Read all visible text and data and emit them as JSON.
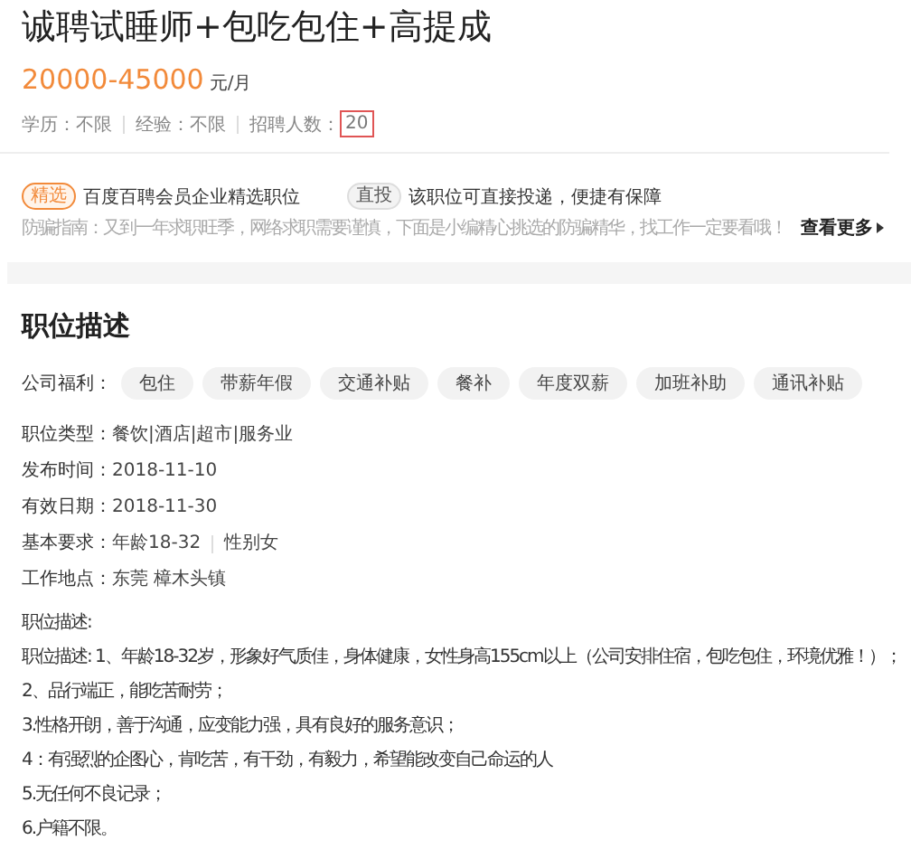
{
  "job": {
    "title": "诚聘试睡师+包吃包住+高提成",
    "salary": "20000-45000",
    "salary_unit": "元/月",
    "requirements": [
      {
        "label": "学历：",
        "value": "不限",
        "highlighted": false
      },
      {
        "label": "经验：",
        "value": "不限",
        "highlighted": false
      },
      {
        "label": "招聘人数：",
        "value": "20",
        "highlighted": true
      }
    ]
  },
  "features": [
    {
      "badge": "精选",
      "kind": "accent",
      "text": "百度百聘会员企业精选职位"
    },
    {
      "badge": "直投",
      "kind": "plain",
      "text": "该职位可直接投递，便捷有保障"
    }
  ],
  "fraud_tip": {
    "text": "防骗指南：又到一年求职旺季，网络求职需要谨慎，下面是小编精心挑选的防骗精华，找工作一定要看哦！",
    "link": "查看更多"
  },
  "description": {
    "heading": "职位描述",
    "benefits_label": "公司福利：",
    "benefits": [
      "包住",
      "带薪年假",
      "交通补贴",
      "餐补",
      "年度双薪",
      "加班补助",
      "通讯补贴"
    ],
    "fields": [
      {
        "label": "职位类型：",
        "value": "餐饮|酒店|超市|服务业"
      },
      {
        "label": "发布时间：",
        "value": "2018-11-10"
      },
      {
        "label": "有效日期：",
        "value": "2018-11-30"
      },
      {
        "label": "基本要求：",
        "value": "年龄18-32",
        "value_2": "性别女"
      },
      {
        "label": "工作地点：",
        "value": "东莞 樟木头镇"
      }
    ],
    "body_heading": "职位描述:",
    "body_lines": [
      "职位描述: 1、年龄18-32岁，形象好气质佳，身体健康，女性身高155cm以上（公司安排住宿，包吃包住，环境优雅！）；",
      "2、品行端正，能吃苦耐劳；",
      "3.性格开朗，善于沟通，应变能力强，具有良好的服务意识；",
      "4：有强烈的企图心，肯吃苦，有干劲，有毅力，希望能改变自己命运的人",
      "5.无任何不良记录；",
      "6.户籍不限。"
    ]
  }
}
